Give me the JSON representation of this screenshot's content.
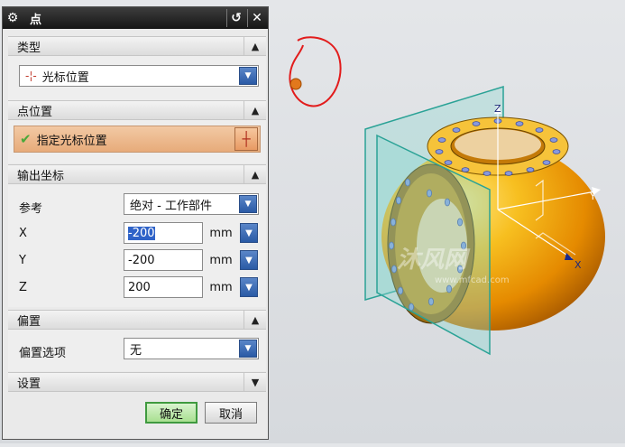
{
  "dialog": {
    "title": "点",
    "sections": {
      "type": {
        "title": "类型",
        "selected": "光标位置"
      },
      "point_location": {
        "title": "点位置",
        "specify_label": "指定光标位置"
      },
      "output_coords": {
        "title": "输出坐标",
        "reference_label": "参考",
        "reference_value": "绝对 - 工作部件",
        "x_label": "X",
        "x_value": "-200",
        "y_label": "Y",
        "y_value": "-200",
        "z_label": "Z",
        "z_value": "200",
        "unit": "mm"
      },
      "offset": {
        "title": "偏置",
        "option_label": "偏置选项",
        "option_value": "无"
      },
      "settings": {
        "title": "设置"
      }
    },
    "buttons": {
      "ok": "确定",
      "cancel": "取消"
    }
  },
  "viewport": {
    "axis_x": "X",
    "axis_y": "Y",
    "axis_z": "Z",
    "watermark": "沐风网",
    "watermark_url": "www.mfcad.com"
  },
  "colors": {
    "part": "#f2ad14",
    "plane": "#7fd4c8",
    "annotation": "#e21c1c",
    "point_marker": "#e2781c"
  },
  "icons": {
    "settings": "gear-icon",
    "reset": "reset-icon",
    "close": "close-icon",
    "collapse": "chevron-up-icon",
    "expand": "chevron-down-icon",
    "check": "check-icon",
    "cursor": "crosshair-icon"
  }
}
